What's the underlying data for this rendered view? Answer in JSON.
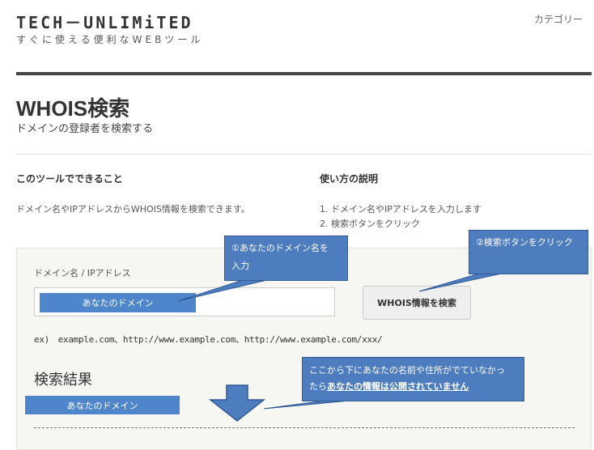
{
  "header": {
    "logo": "TECH－UNLIMiTED",
    "tagline": "すぐに使える便利なWEBツール",
    "category_link": "カテゴリー"
  },
  "page": {
    "title": "WHOIS検索",
    "subtitle": "ドメインの登録者を検索する"
  },
  "about": {
    "heading": "このツールでできること",
    "text": "ドメイン名やIPアドレスからWHOIS情報を検索できます。"
  },
  "howto": {
    "heading": "使い方の説明",
    "steps": [
      "1. ドメイン名やIPアドレスを入力します",
      "2. 検索ボタンをクリック"
    ]
  },
  "form": {
    "label": "ドメイン名 / IPアドレス",
    "input_value": "あなたのドメイン",
    "button_label": "WHOIS情報を検索",
    "example": "ex)　example.com、http://www.example.com、http://www.example.com/xxx/"
  },
  "results": {
    "heading": "検索結果",
    "value": "あなたのドメイン"
  },
  "callouts": {
    "c1_line1": "①あなたのドメイン名を",
    "c1_line2": "入力",
    "c2": "②検索ボタンをクリック",
    "c3_line1": "ここから下にあなたの名前や住所がでていなかっ",
    "c3_prefix": "たら",
    "c3_emphasis": "あなたの情報は公開されていません"
  },
  "colors": {
    "accent_blue": "#4e7dbf",
    "header_rule": "#444444"
  }
}
